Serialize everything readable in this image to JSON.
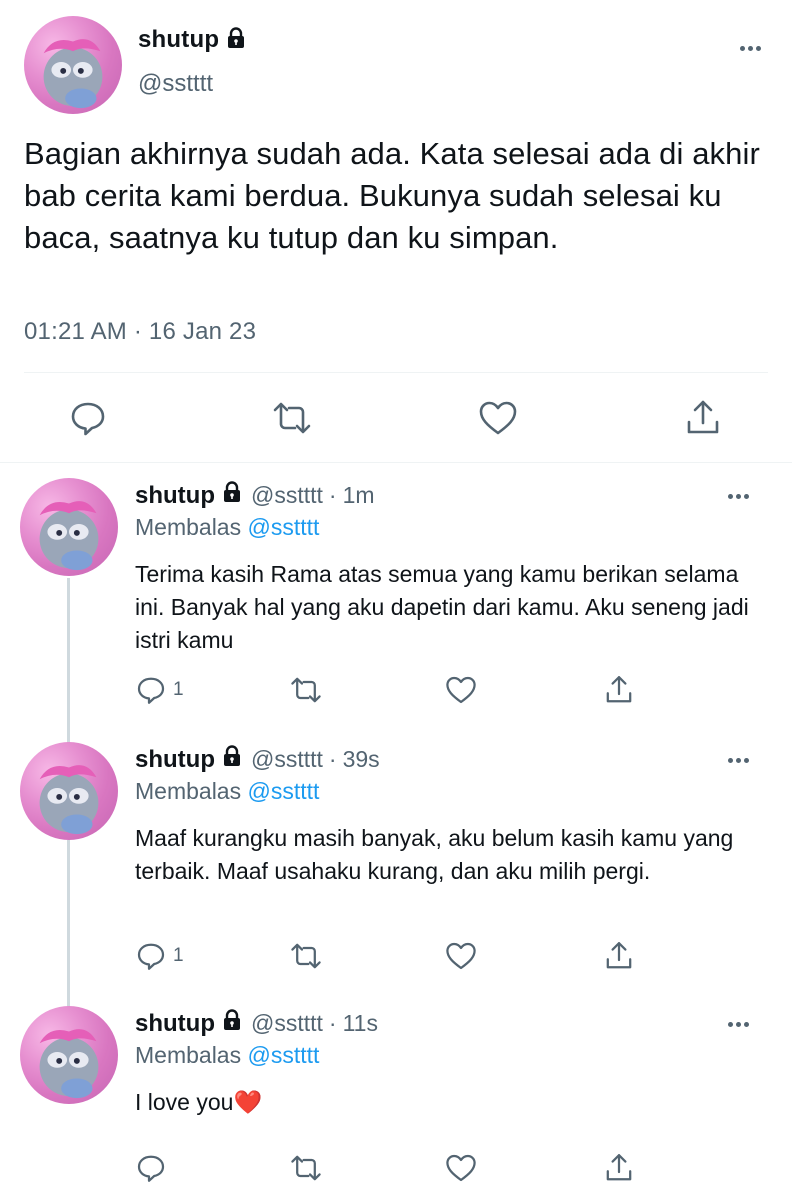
{
  "main_tweet": {
    "name": "shutup",
    "handle": "@sstttt",
    "text": "Bagian akhirnya sudah ada. Kata selesai ada di akhir bab cerita kami berdua. Bukunya sudah selesai ku baca, saatnya ku tutup dan ku simpan.",
    "timestamp": "01:21 AM · 16 Jan 23",
    "icons": {
      "avatar": "avatar-image",
      "lock": "lock-icon",
      "more": "more-icon",
      "reply": "reply-icon",
      "retweet": "retweet-icon",
      "like": "heart-icon",
      "share": "share-icon"
    }
  },
  "replies": [
    {
      "name": "shutup",
      "handle": "@sstttt",
      "separator": "·",
      "time": "1m",
      "replying_label": "Membalas",
      "replying_to": "@sstttt",
      "text": "Terima kasih Rama atas semua yang kamu berikan selama ini. Banyak hal yang aku dapetin dari kamu. Aku seneng jadi istri kamu",
      "reply_count": "1"
    },
    {
      "name": "shutup",
      "handle": "@sstttt",
      "separator": "·",
      "time": "39s",
      "replying_label": "Membalas",
      "replying_to": "@sstttt",
      "text": "Maaf kurangku masih banyak, aku belum kasih kamu yang terbaik. Maaf usahaku kurang, dan aku milih pergi.",
      "reply_count": "1"
    },
    {
      "name": "shutup",
      "handle": "@sstttt",
      "separator": "·",
      "time": "11s",
      "replying_label": "Membalas",
      "replying_to": "@sstttt",
      "text": "I love you❤️",
      "reply_count": ""
    }
  ],
  "colors": {
    "text_primary": "#0f1419",
    "text_secondary": "#536471",
    "link": "#1d9bf0",
    "divider": "#eff3f4",
    "thread_line": "#cfd9de"
  }
}
